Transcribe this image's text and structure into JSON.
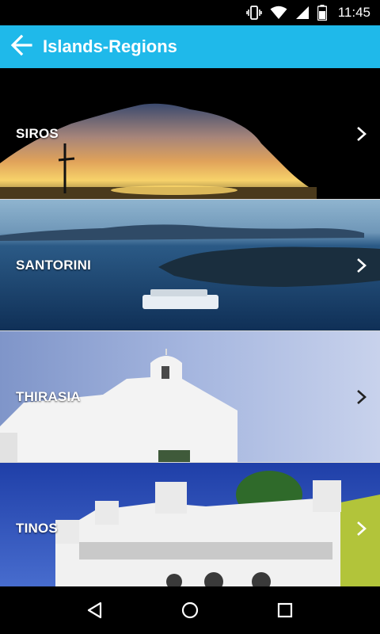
{
  "status_bar": {
    "time": "11:45",
    "icons": [
      "vibrate-icon",
      "wifi-icon",
      "signal-icon",
      "battery-icon"
    ]
  },
  "app_bar": {
    "title": "Islands-Regions",
    "back_icon": "arrow-back-icon",
    "color": "#1fb9ea"
  },
  "regions": [
    {
      "name": "SIROS"
    },
    {
      "name": "SANTORINI"
    },
    {
      "name": "THIRASIA"
    },
    {
      "name": "TINOS"
    }
  ],
  "nav_bar": {
    "buttons": [
      "back-triangle-icon",
      "home-circle-icon",
      "recents-square-icon"
    ]
  }
}
